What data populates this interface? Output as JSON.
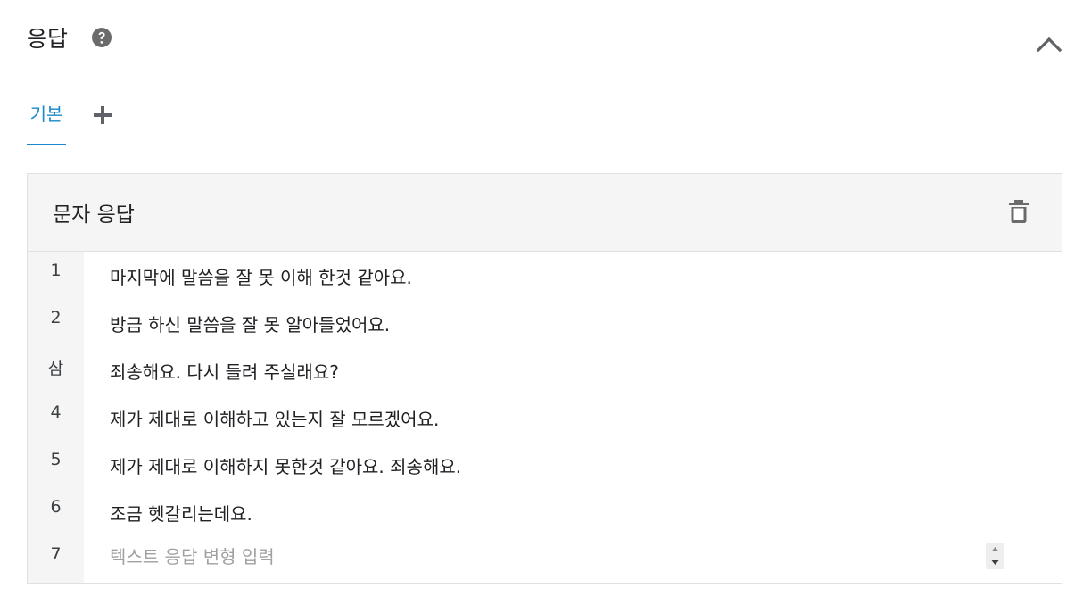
{
  "section": {
    "title": "응답",
    "help_icon": "help-circle-icon",
    "collapse_icon": "chevron-up-icon"
  },
  "tabs": [
    {
      "label": "기본",
      "active": true
    },
    {
      "label": "+",
      "icon": "plus-icon"
    }
  ],
  "card": {
    "title": "문자 응답",
    "delete_icon": "trash-icon",
    "rows": [
      {
        "num": "1",
        "text": "마지막에 말씀을 잘 못 이해 한것 같아요."
      },
      {
        "num": "2",
        "text": "방금 하신 말씀을 잘 못 알아들었어요."
      },
      {
        "num": "삼",
        "text": "죄송해요. 다시 들려 주실래요?"
      },
      {
        "num": "4",
        "text": "제가 제대로 이해하고 있는지 잘 모르겠어요."
      },
      {
        "num": "5",
        "text": "제가 제대로 이해하지 못한것 같아요. 죄송해요."
      },
      {
        "num": "6",
        "text": "조금 헷갈리는데요."
      }
    ],
    "new_row": {
      "num": "7",
      "value": "",
      "placeholder": "텍스트 응답 변형 입력"
    }
  },
  "colors": {
    "accent": "#1a88c9",
    "header_bg": "#f5f5f5",
    "icon_gray": "#6b6b6b"
  }
}
